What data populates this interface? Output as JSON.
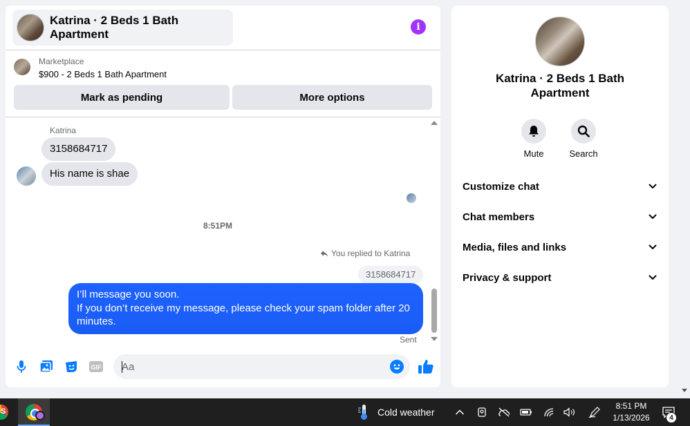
{
  "chat": {
    "title": "Katrina · 2 Beds 1 Bath Apartment",
    "marketplace_label": "Marketplace",
    "listing": "$900 - 2 Beds 1 Bath Apartment",
    "mark_pending": "Mark as pending",
    "more_options": "More options",
    "sender_name": "Katrina",
    "messages_in": [
      "3158684717",
      "His name is shae"
    ],
    "time_divider": "8:51PM",
    "reply_note": "You replied to Katrina",
    "reply_quote": "3158684717",
    "message_out_line1": "I’ll message you soon.",
    "message_out_line2": "If you don’t receive my message, please check your spam folder after 20 minutes.",
    "status": "Sent",
    "composer_placeholder": "Aa",
    "accent_color": "#0a7cff"
  },
  "info_panel": {
    "title": "Katrina · 2 Beds 1 Bath Apartment",
    "actions": [
      {
        "label": "Mute",
        "icon": "bell-icon"
      },
      {
        "label": "Search",
        "icon": "search-icon"
      }
    ],
    "sections": [
      "Customize chat",
      "Chat members",
      "Media, files and links",
      "Privacy & support"
    ]
  },
  "taskbar": {
    "weather": "Cold weather",
    "time": "8:51 PM",
    "date": "1/13/2026",
    "notification_count": "4"
  }
}
